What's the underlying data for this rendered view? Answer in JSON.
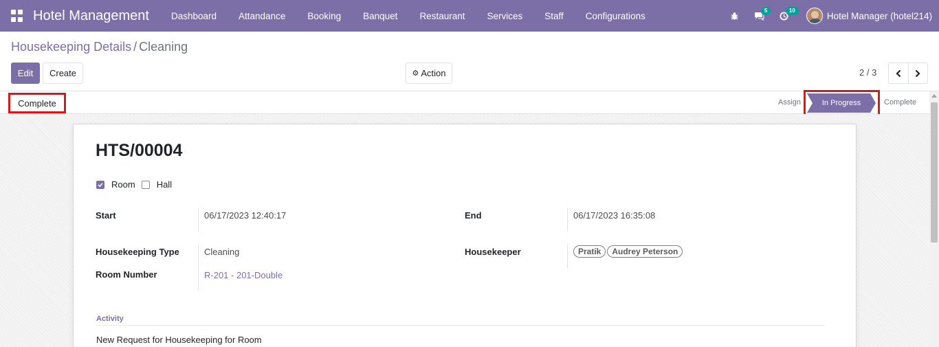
{
  "navbar": {
    "app_title": "Hotel Management",
    "menu": [
      "Dashboard",
      "Attandance",
      "Booking",
      "Banquet",
      "Restaurant",
      "Services",
      "Staff",
      "Configurations"
    ],
    "messages_count": "5",
    "activities_count": "10",
    "user_name": "Hotel Manager (hotel214)",
    "icons": [
      "apps-icon",
      "bug-icon",
      "chat-icon",
      "clock-icon"
    ],
    "color": "#7c6ea6"
  },
  "breadcrumb": {
    "parent": "Housekeeping Details",
    "separator": "/",
    "current": "Cleaning"
  },
  "toolbar": {
    "edit": "Edit",
    "create": "Create",
    "action": "Action"
  },
  "pager": {
    "value": "2 / 3"
  },
  "statusbar": {
    "complete_button": "Complete",
    "stages": [
      "Assign",
      "In Progress",
      "Complete"
    ],
    "active_stage": "In Progress"
  },
  "form": {
    "title": "HTS/00004",
    "room_label": "Room",
    "room_checked": true,
    "hall_label": "Hall",
    "hall_checked": false,
    "start_label": "Start",
    "start_value": "06/17/2023 12:40:17",
    "end_label": "End",
    "end_value": "06/17/2023 16:35:08",
    "type_label": "Housekeeping Type",
    "type_value": "Cleaning",
    "housekeeper_label": "Housekeeper",
    "housekeepers": [
      "Pratik",
      "Audrey Peterson"
    ],
    "room_number_label": "Room Number",
    "room_number_value": "R-201 - 201-Double",
    "activity_label": "Activity",
    "activity_text": "New Request for Housekeeping for Room"
  }
}
